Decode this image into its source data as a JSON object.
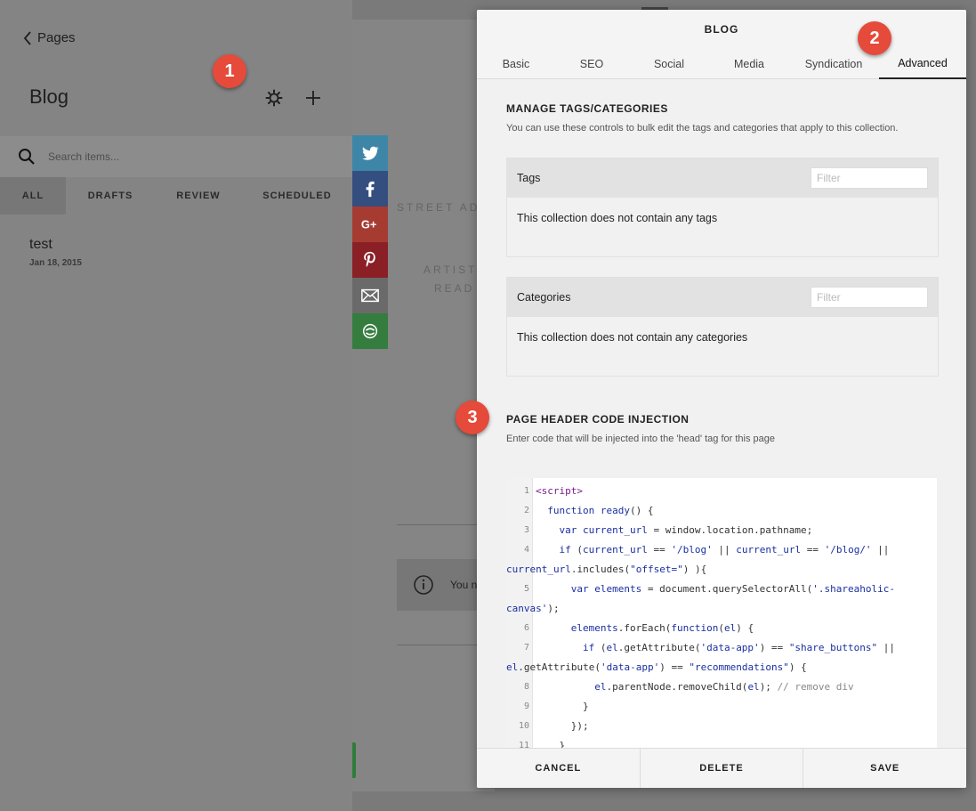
{
  "left_panel": {
    "back_label": "Pages",
    "title": "Blog",
    "search_placeholder": "Search items...",
    "filter_tabs": [
      "ALL",
      "DRAFTS",
      "REVIEW",
      "SCHEDULED"
    ],
    "active_filter": "ALL",
    "post": {
      "title": "test",
      "date": "Jan 18, 2015"
    }
  },
  "badges": [
    "1",
    "2",
    "3"
  ],
  "preview": {
    "share_buttons": [
      {
        "icon": "twitter-icon",
        "color": "#3d86a8"
      },
      {
        "icon": "facebook-icon",
        "color": "#354e80"
      },
      {
        "icon": "google-plus-icon",
        "color": "#a63b32"
      },
      {
        "icon": "pinterest-icon",
        "color": "#8a1f26"
      },
      {
        "icon": "email-icon",
        "color": "#6a6a6a"
      },
      {
        "icon": "shareaholic-icon",
        "color": "#357d3f"
      }
    ],
    "text_1": "STREET AD",
    "text_2": "ARTISTS",
    "text_3": "READ",
    "note_text": "You n"
  },
  "modal": {
    "title": "BLOG",
    "tabs": [
      "Basic",
      "SEO",
      "Social",
      "Media",
      "Syndication",
      "Advanced"
    ],
    "active_tab": "Advanced",
    "manage_title": "MANAGE TAGS/CATEGORIES",
    "manage_desc": "You can use these controls to bulk edit the tags and categories that apply to this collection.",
    "tags": {
      "label": "Tags",
      "filter_placeholder": "Filter",
      "empty": "This collection does not contain any tags"
    },
    "categories": {
      "label": "Categories",
      "filter_placeholder": "Filter",
      "empty": "This collection does not contain any categories"
    },
    "injection_title": "PAGE HEADER CODE INJECTION",
    "injection_desc": "Enter code that will be injected into the 'head' tag for this page",
    "code_line_numbers": [
      "1",
      "2",
      "3",
      "4",
      "",
      "5",
      "",
      "6",
      "7",
      "",
      "8",
      "9",
      "10",
      "11"
    ],
    "footer": {
      "cancel": "CANCEL",
      "delete": "DELETE",
      "save": "SAVE"
    }
  },
  "colors": {
    "badge": "#e54a3a",
    "overlay": "#848484"
  }
}
